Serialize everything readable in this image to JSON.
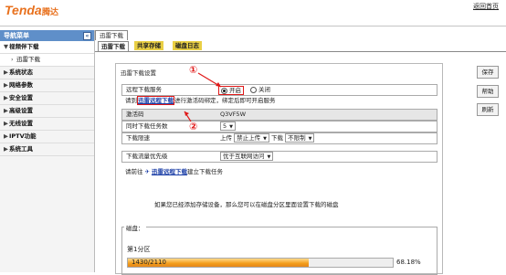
{
  "header": {
    "logo": "Tenda",
    "logo_cn": "腾达",
    "home_link": "返回首页"
  },
  "sidebar": {
    "title": "导航菜单",
    "collapse": "«",
    "items": [
      {
        "label": "视频伴下载",
        "arrow": "▼",
        "active": true
      },
      {
        "label": "迅雷下载",
        "arrow": "›",
        "sub": true
      },
      {
        "label": "系统状态",
        "arrow": "▶"
      },
      {
        "label": "网络参数",
        "arrow": "▶"
      },
      {
        "label": "安全设置",
        "arrow": "▶"
      },
      {
        "label": "高级设置",
        "arrow": "▶"
      },
      {
        "label": "无线设置",
        "arrow": "▶"
      },
      {
        "label": "IPTV功能",
        "arrow": "▶"
      },
      {
        "label": "系统工具",
        "arrow": "▶"
      }
    ]
  },
  "main": {
    "outer_tab": "迅雷下载",
    "tabs": [
      {
        "label": "迅雷下载"
      },
      {
        "label": "共享存储"
      },
      {
        "label": "磁盘日志"
      }
    ],
    "panel_title": "迅雷下载设置",
    "remote_service": {
      "label": "远程下载服务",
      "on": "开启",
      "off": "关闭"
    },
    "bind_hint": {
      "prefix": "请到",
      "link": "迅雷远程下载",
      "suffix": "进行激活码绑定，绑定后即可开启服务"
    },
    "activation": {
      "label": "激活码",
      "value": "Q3VF5W"
    },
    "tasks": {
      "label": "同时下载任务数",
      "value": "5"
    },
    "speed": {
      "label": "下载限速",
      "up_label": "上传",
      "up_value": "禁止上传",
      "down_label": "下载",
      "down_value": "不限制"
    },
    "priority": {
      "label": "下载流量优先级",
      "value": "优于互联网访问"
    },
    "goto": {
      "prefix": "请前往",
      "link": "迅雷远程下载",
      "suffix": "建立下载任务"
    },
    "note": "如果您已经添加存储设备，那么您可以在磁盘分区里面设置下载的磁盘",
    "disk": {
      "title": "磁盘：",
      "partition": "第1分区",
      "usage_text": "1430/2110",
      "percent_text": "68.18%",
      "usage_fraction": 0.6818
    },
    "annotations": {
      "one": "①",
      "two": "②"
    },
    "buttons": {
      "save": "保存",
      "help": "帮助",
      "refresh": "刷新"
    }
  },
  "colors": {
    "accent": "#e8711e",
    "nav": "#5f8fc9",
    "highlight": "#e9cf45",
    "annotation": "#e01818"
  }
}
